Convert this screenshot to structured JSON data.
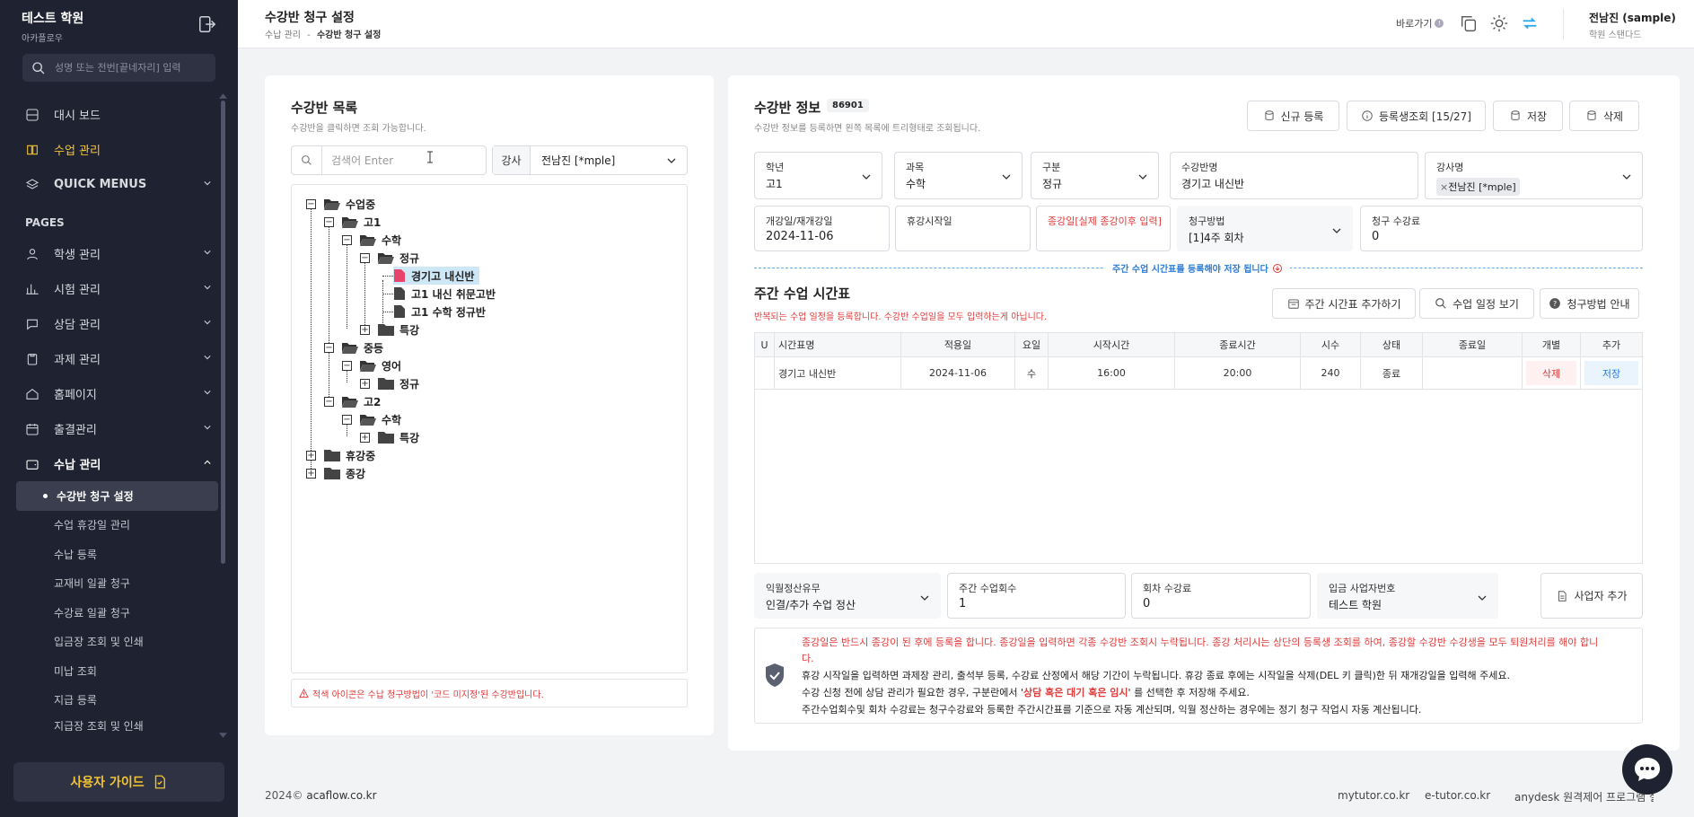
{
  "sidebar": {
    "academy_name": "테스트 학원",
    "academy_sub": "아카플로우",
    "search_placeholder": "성명 또는 전번[끝네자리] 입력",
    "items": [
      {
        "label": "대시 보드"
      },
      {
        "label": "수업 관리"
      },
      {
        "label": "QUICK MENUS"
      }
    ],
    "section_pages": "PAGES",
    "pages": [
      {
        "label": "학생 관리"
      },
      {
        "label": "시험 관리"
      },
      {
        "label": "상담 관리"
      },
      {
        "label": "과제 관리"
      },
      {
        "label": "홈페이지"
      },
      {
        "label": "출결관리"
      },
      {
        "label": "수납 관리"
      }
    ],
    "sub_items": [
      {
        "label": "수강반 청구 설정"
      },
      {
        "label": "수업 휴강일 관리"
      },
      {
        "label": "수납 등록"
      },
      {
        "label": "교재비 일괄 청구"
      },
      {
        "label": "수강료 일괄 청구"
      },
      {
        "label": "입금장 조회 및 인쇄"
      },
      {
        "label": "미납 조회"
      },
      {
        "label": "지급 등록"
      },
      {
        "label": "지급장 조회 및 인쇄"
      }
    ],
    "guide_label": "사용자 가이드"
  },
  "header": {
    "title": "수강반 청구 설정",
    "breadcrumb_parent": "수납 관리",
    "breadcrumb_sep": "-",
    "breadcrumb_current": "수강반 청구 설정",
    "shortcut_label": "바로가기",
    "user_name": "전남진 (sample)",
    "user_plan": "학원 스탠다드"
  },
  "left": {
    "title": "수강반 목록",
    "desc": "수강반을 클릭하면 조회 가능합니다.",
    "search_placeholder": "검색어 Enter",
    "teacher_label": "강사",
    "teacher_value": "전남진 [*mple]",
    "tree": {
      "n1": "수업중",
      "n2": "고1",
      "n3": "수학",
      "n4": "정규",
      "n5": "경기고 내신반",
      "n6": "고1 내신 취문고반",
      "n7": "고1 수학 정규반",
      "n8": "특강",
      "n9": "중등",
      "n10": "영어",
      "n11": "정규",
      "n12": "고2",
      "n13": "수학",
      "n14": "특강",
      "n15": "휴강중",
      "n16": "종강"
    },
    "warning": "적색 아이콘은 수납 청구방법이 '코드 미지정'된 수강반입니다."
  },
  "right": {
    "title": "수강반 정보",
    "code": "86901",
    "desc": "수강반 정보를 등록하면 왼쪽 목록에 트리형태로 조회됩니다.",
    "buttons": {
      "new": "신규 등록",
      "students": "등록생조회 [15/27]",
      "save": "저장",
      "delete": "삭제"
    },
    "fields": {
      "grade_label": "학년",
      "grade_value": "고1",
      "subject_label": "과목",
      "subject_value": "수학",
      "type_label": "구분",
      "type_value": "정규",
      "class_label": "수강반명",
      "class_value": "경기고 내신반",
      "teacher_label": "강사명",
      "teacher_chip": "전남진 [*mple]",
      "start_label": "개강일/재개강일",
      "start_value": "2024-11-06",
      "break_label": "휴강시작일",
      "break_value": "",
      "end_label": "종강일[실제 종강이후 입력]",
      "end_value": "",
      "billing_label": "청구방법",
      "billing_value": "[1]4주 회차",
      "fee_label": "청구 수강료",
      "fee_value": "0"
    },
    "divider_text": "주간 수업 시간표를 등록해야 저장 됩니다",
    "schedule": {
      "title": "주간 수업 시간표",
      "desc": "반복되는 수업 일정을 등록합니다. 수강반 수업일을 모두 입력하는게 아닙니다.",
      "btn_add": "주간 시간표 추가하기",
      "btn_view": "수업 일정 보기",
      "btn_guide": "청구방법 안내",
      "columns": [
        "U",
        "시간표명",
        "적용일",
        "요일",
        "시작시간",
        "종료시간",
        "시수",
        "상태",
        "종료일",
        "개별",
        "추가"
      ],
      "rows": [
        {
          "name": "경기고 내신반",
          "date": "2024-11-06",
          "day": "수",
          "start": "16:00",
          "end": "20:00",
          "hours": "240",
          "status": "종료",
          "end_date": "",
          "del": "삭제",
          "save": "저장"
        }
      ]
    },
    "bottom_fields": {
      "settle_label": "익월정산유무",
      "settle_value": "인결/추가 수업 정산",
      "weekly_label": "주간 수업회수",
      "weekly_value": "1",
      "per_fee_label": "회차 수강료",
      "per_fee_value": "0",
      "biz_label": "입금 사업자번호",
      "biz_value": "테스트 학원",
      "biz_add": "사업자 추가"
    },
    "notice": {
      "l1": "종강일은 반드시 종강이 된 후에 등록을 합니다. 종강일을 입력하면 각종 수강반 조회시 누락됩니다. 종강 처리시는 상단의 등록생 조회를 하여, 종강할 수강반 수강생을 모두 퇴원처리를 해야 합니",
      "l1b": "다.",
      "l2": "휴강 시작일을 입력하면 과제장 관리, 출석부 등록, 수강료 산정에서 해당 기간이 누락됩니다. 휴강 종료 후에는 시작일을 삭제(DEL 키 클릭)한 뒤 재개강일을 입력해 주세요.",
      "l3a": "수강 신청 전에 상담 관리가 필요한 경우, 구분란에서 '",
      "l3hl": "상담 혹은 대기 혹은 임시",
      "l3b": "' 를 선택한 후 저장해 주세요.",
      "l4": "주간수업회수및 회차 수강료는 청구수강료와 등록한 주간시간표를 기준으로 자동 계산되며, 익월 정산하는 경우에는 정기 청구 작업시 자동 계산됩니다."
    }
  },
  "footer": {
    "year": "2024©",
    "site": "acaflow.co.kr",
    "links": [
      "mytutor.co.kr",
      "e-tutor.co.kr",
      "anydesk 원격제어 프로그램 설치"
    ]
  },
  "colors": {
    "sidebar_bg": "#1f2230",
    "accent_yellow": "#f4c430",
    "accent_blue": "#2a7bd6",
    "danger_red": "#e03c3c"
  }
}
